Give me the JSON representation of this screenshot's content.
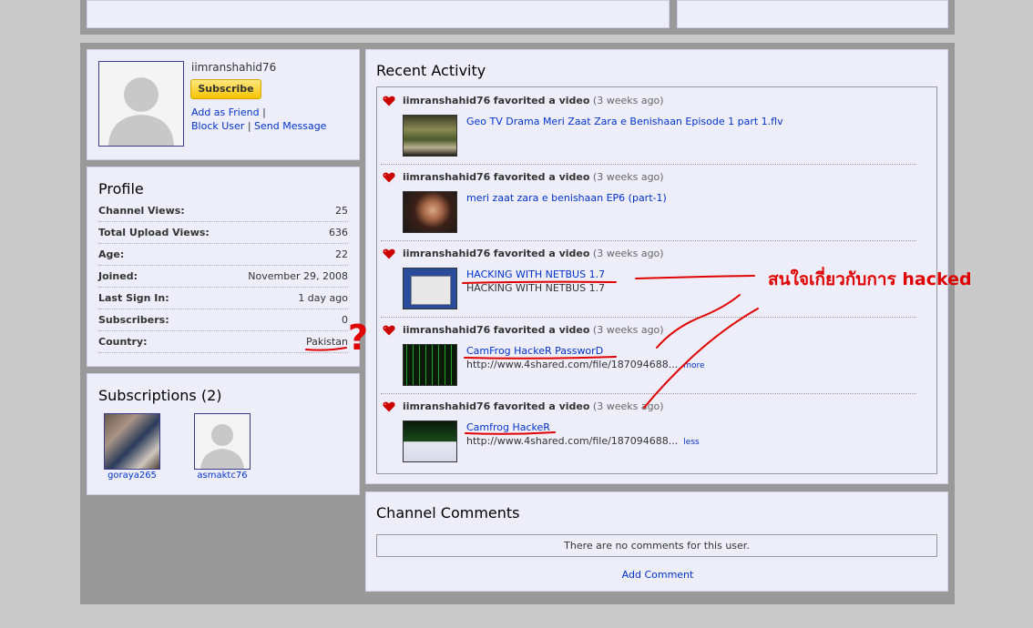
{
  "user": {
    "username": "iimranshahid76",
    "subscribe_label": "Subscribe",
    "add_friend": "Add as Friend",
    "block_user": "Block User",
    "send_message": "Send Message"
  },
  "profile": {
    "heading": "Profile",
    "rows": [
      {
        "label": "Channel Views:",
        "value": "25"
      },
      {
        "label": "Total Upload Views:",
        "value": "636"
      },
      {
        "label": "Age:",
        "value": "22"
      },
      {
        "label": "Joined:",
        "value": "November 29, 2008"
      },
      {
        "label": "Last Sign In:",
        "value": "1 day ago"
      },
      {
        "label": "Subscribers:",
        "value": "0"
      },
      {
        "label": "Country:",
        "value": "Pakistan"
      }
    ]
  },
  "subscriptions": {
    "heading": "Subscriptions (2)",
    "items": [
      {
        "name": "goraya265"
      },
      {
        "name": "asmaktc76"
      }
    ]
  },
  "activity": {
    "heading": "Recent Activity",
    "items": [
      {
        "user": "iimranshahid76",
        "action": "favorited a video",
        "ago": "(3 weeks ago)",
        "title": "Geo TV Drama Meri Zaat Zara e Benishaan Episode 1 part 1.flv",
        "desc": "",
        "toggle": ""
      },
      {
        "user": "iimranshahid76",
        "action": "favorited a video",
        "ago": "(3 weeks ago)",
        "title": "meri zaat zara e benishaan EP6 (part-1)",
        "desc": "",
        "toggle": ""
      },
      {
        "user": "iimranshahid76",
        "action": "favorited a video",
        "ago": "(3 weeks ago)",
        "title": "HACKING WITH NETBUS 1.7",
        "desc": "HACKING WITH NETBUS 1.7",
        "toggle": ""
      },
      {
        "user": "iimranshahid76",
        "action": "favorited a video",
        "ago": "(3 weeks ago)",
        "title": "CamFrog HackeR PassworD",
        "desc": "http://www.4shared.com/file/187094688...",
        "toggle": "more"
      },
      {
        "user": "iimranshahid76",
        "action": "favorited a video",
        "ago": "(3 weeks ago)",
        "title": "Camfrog HackeR",
        "desc": "http://www.4shared.com/file/187094688...",
        "toggle": "less"
      }
    ]
  },
  "comments": {
    "heading": "Channel Comments",
    "empty_text": "There are no comments for this user.",
    "add_label": "Add Comment"
  },
  "annotations": {
    "thai_note": "สนใจเกี่ยวกับการ hacked",
    "question_mark": "?",
    "color": "#e00000"
  }
}
